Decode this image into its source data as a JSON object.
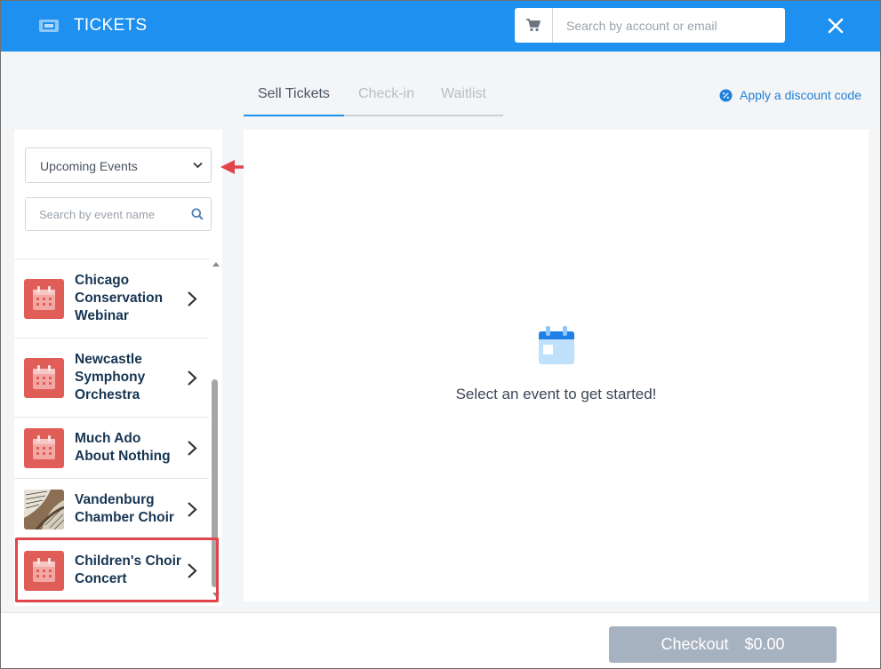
{
  "header": {
    "title": "TICKETS",
    "search_placeholder": "Search by account or email",
    "ticket_icon": "ticket-icon",
    "cart_icon": "cart-icon",
    "close_icon": "close-icon"
  },
  "tabs": [
    {
      "label": "Sell Tickets",
      "active": true
    },
    {
      "label": "Check-in",
      "active": false
    },
    {
      "label": "Waitlist",
      "active": false
    }
  ],
  "discount": {
    "label": "Apply a discount code",
    "icon": "discount-badge-icon"
  },
  "filter": {
    "selected": "Upcoming Events"
  },
  "event_search": {
    "placeholder": "Search by event name"
  },
  "events": [
    {
      "name": "Chicago Conservation Webinar",
      "thumb": "calendar-icon"
    },
    {
      "name": "Newcastle Symphony Orchestra",
      "thumb": "calendar-icon"
    },
    {
      "name": "Much Ado About Nothing",
      "thumb": "calendar-icon"
    },
    {
      "name": "Vandenburg Chamber Choir",
      "thumb": "sheet-music-photo"
    },
    {
      "name": "Children's Choir Concert",
      "thumb": "calendar-icon"
    }
  ],
  "main": {
    "empty_message": "Select an event to get started!",
    "icon": "calendar-icon"
  },
  "footer": {
    "checkout_label": "Checkout",
    "total": "$0.00"
  },
  "colors": {
    "brand": "#1e90f0",
    "calendar_thumb": "#e15d58",
    "annotation": "#e0454a",
    "checkout_disabled": "#a7b2c1"
  }
}
